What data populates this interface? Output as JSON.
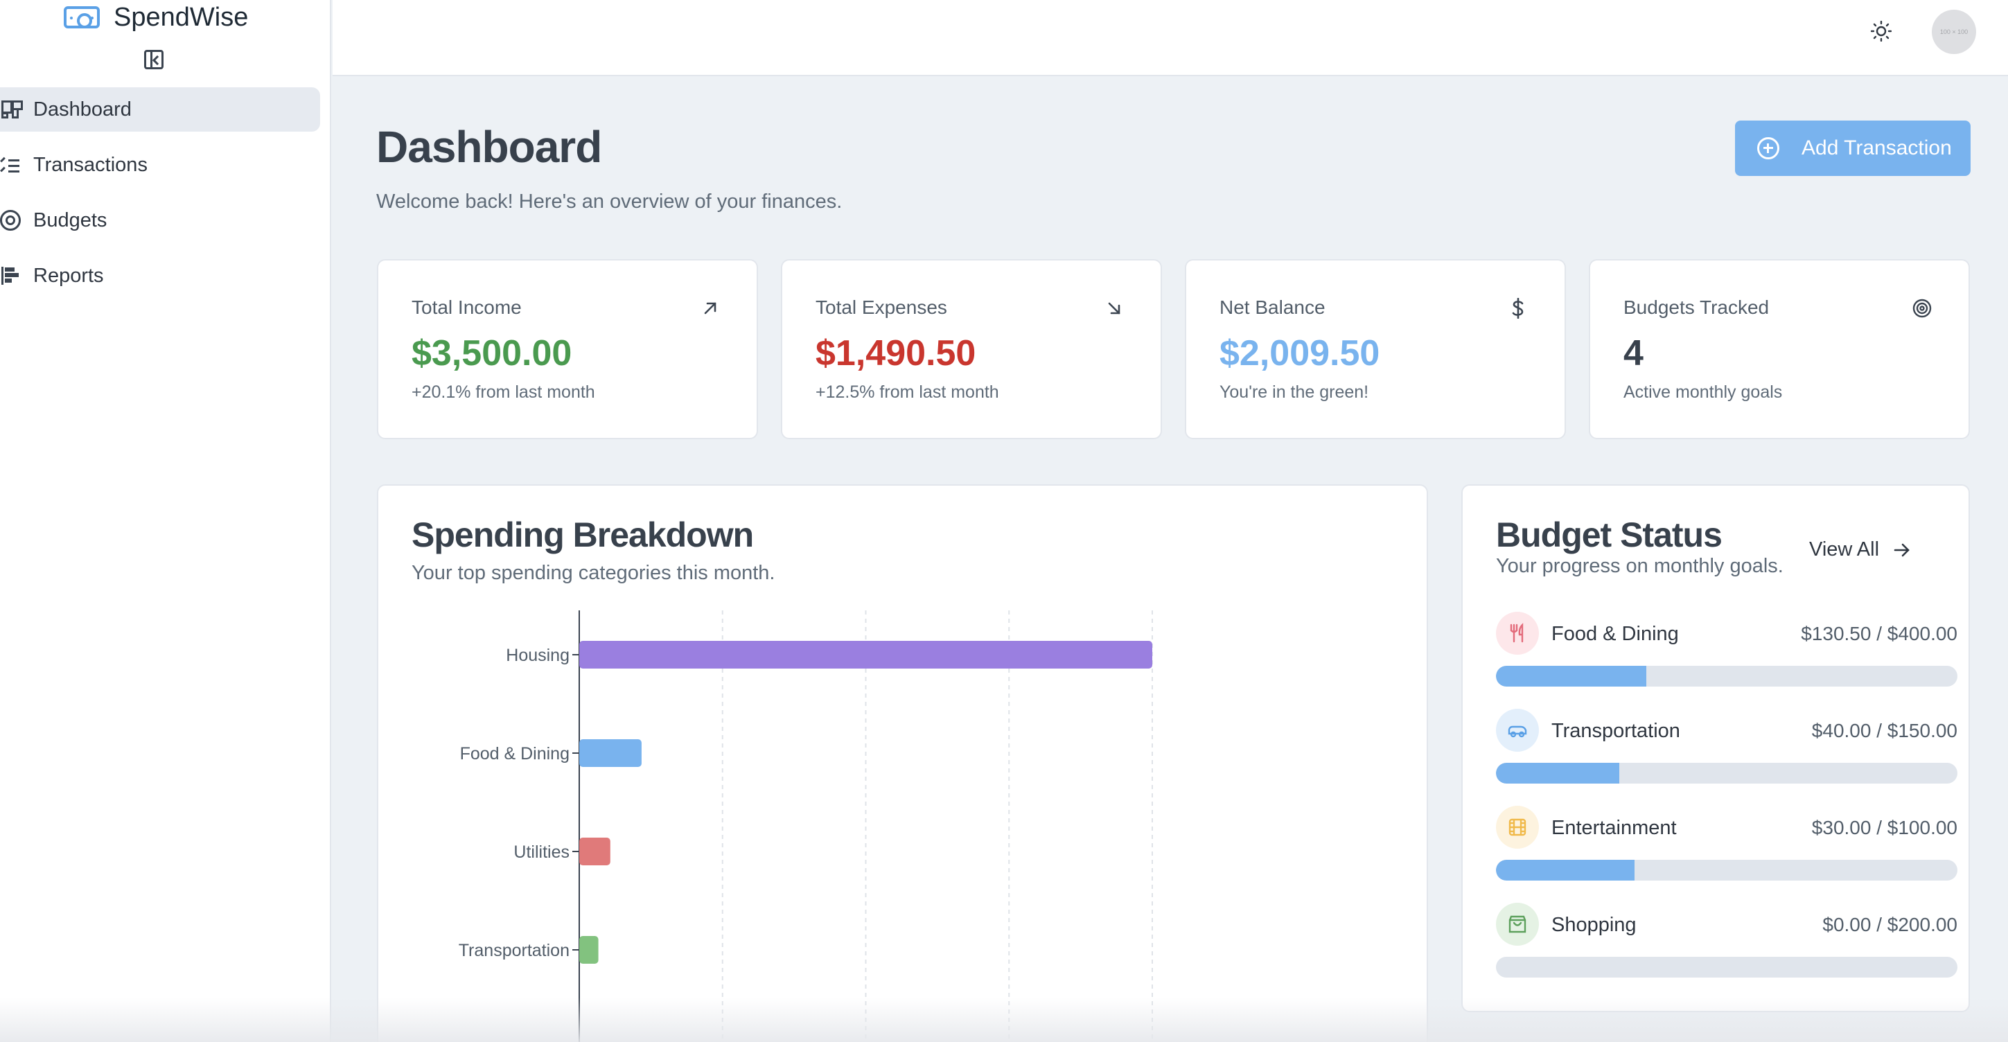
{
  "app": {
    "name": "SpendWise"
  },
  "sidebar": {
    "items": [
      {
        "label": "Dashboard",
        "active": true
      },
      {
        "label": "Transactions",
        "active": false
      },
      {
        "label": "Budgets",
        "active": false
      },
      {
        "label": "Reports",
        "active": false
      }
    ]
  },
  "topbar": {
    "avatar_placeholder": "100 × 100"
  },
  "header": {
    "title": "Dashboard",
    "subtitle": "Welcome back! Here's an overview of your finances.",
    "add_button_label": "Add Transaction"
  },
  "stats": [
    {
      "label": "Total Income",
      "value": "$3,500.00",
      "note": "+20.1% from last month",
      "icon": "arrow-up-right-icon",
      "color": "#4a9a4f"
    },
    {
      "label": "Total Expenses",
      "value": "$1,490.50",
      "note": "+12.5% from last month",
      "icon": "arrow-down-right-icon",
      "color": "#c9362e"
    },
    {
      "label": "Net Balance",
      "value": "$2,009.50",
      "note": "You're in the green!",
      "icon": "dollar-icon",
      "color": "#79b3ee"
    },
    {
      "label": "Budgets Tracked",
      "value": "4",
      "note": "Active monthly goals",
      "icon": "target-icon",
      "color": "#38414c"
    }
  ],
  "spending": {
    "title": "Spending Breakdown",
    "subtitle": "Your top spending categories this month."
  },
  "chart_data": {
    "type": "bar",
    "orientation": "horizontal",
    "categories": [
      "Housing",
      "Food & Dining",
      "Utilities",
      "Transportation"
    ],
    "values": [
      1200,
      130.5,
      65,
      40
    ],
    "colors": [
      "#9a7fe0",
      "#79b3ee",
      "#e07a7a",
      "#82c27f"
    ],
    "xlim": [
      0,
      1200
    ],
    "grid": true,
    "title": "",
    "xlabel": "",
    "ylabel": ""
  },
  "budget": {
    "title": "Budget Status",
    "subtitle": "Your progress on monthly goals.",
    "view_all_label": "View All",
    "items": [
      {
        "name": "Food & Dining",
        "amount": "$130.50 / $400.00",
        "progress": 0.326,
        "icon": "utensils-icon",
        "icon_color": "#e36b7b",
        "icon_bg": "#fde7ea"
      },
      {
        "name": "Transportation",
        "amount": "$40.00 / $150.00",
        "progress": 0.267,
        "icon": "car-icon",
        "icon_color": "#5aa0e6",
        "icon_bg": "#e3effb"
      },
      {
        "name": "Entertainment",
        "amount": "$30.00 / $100.00",
        "progress": 0.3,
        "icon": "film-icon",
        "icon_color": "#f0b94a",
        "icon_bg": "#fdf3df"
      },
      {
        "name": "Shopping",
        "amount": "$0.00 / $200.00",
        "progress": 0,
        "icon": "shopping-bag-icon",
        "icon_color": "#5da05c",
        "icon_bg": "#e5f2e4"
      }
    ]
  }
}
